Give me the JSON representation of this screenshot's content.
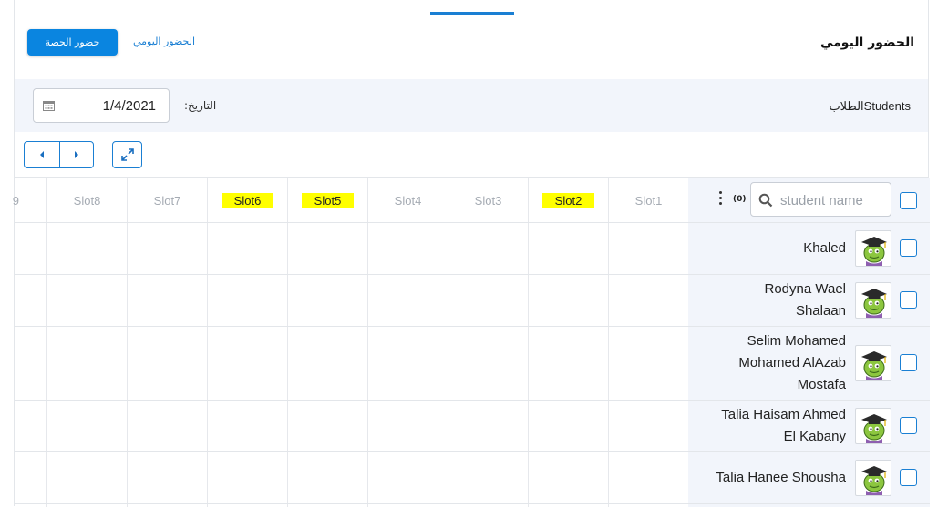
{
  "header": {
    "title": "الحضور اليومي",
    "primary_button": "حضور الحصة",
    "link_tab": "الحضور اليومي"
  },
  "filters": {
    "students_label": "الطلابStudents",
    "date_label": "التاريخ:",
    "date_value": "1/4/2021",
    "date_icon": "calendar-icon"
  },
  "toolbar": {
    "prev_icon": "chevron-left-icon",
    "next_icon": "chevron-right-icon",
    "expand_icon": "expand-icon"
  },
  "table": {
    "search_placeholder": "student name",
    "selected_count": "(0)",
    "partial_slot_label": "9",
    "slots": [
      {
        "label": "Slot1",
        "highlighted": false
      },
      {
        "label": "Slot2",
        "highlighted": true
      },
      {
        "label": "Slot3",
        "highlighted": false
      },
      {
        "label": "Slot4",
        "highlighted": false
      },
      {
        "label": "Slot5",
        "highlighted": true
      },
      {
        "label": "Slot6",
        "highlighted": true
      },
      {
        "label": "Slot7",
        "highlighted": false
      },
      {
        "label": "Slot8",
        "highlighted": false
      }
    ],
    "students": [
      {
        "name_lines": [
          "Khaled"
        ]
      },
      {
        "name_lines": [
          "Rodyna Wael",
          "Shalaan"
        ]
      },
      {
        "name_lines": [
          "Selim Mohamed",
          "Mohamed AlAzab",
          "Mostafa"
        ]
      },
      {
        "name_lines": [
          "Talia Haisam Ahmed",
          "El Kabany"
        ]
      },
      {
        "name_lines": [
          "Talia Hanee Shousha"
        ]
      }
    ]
  },
  "colors": {
    "accent": "#0a85e0",
    "highlight": "#ffff00",
    "panel_bg": "#f2f5fb"
  }
}
